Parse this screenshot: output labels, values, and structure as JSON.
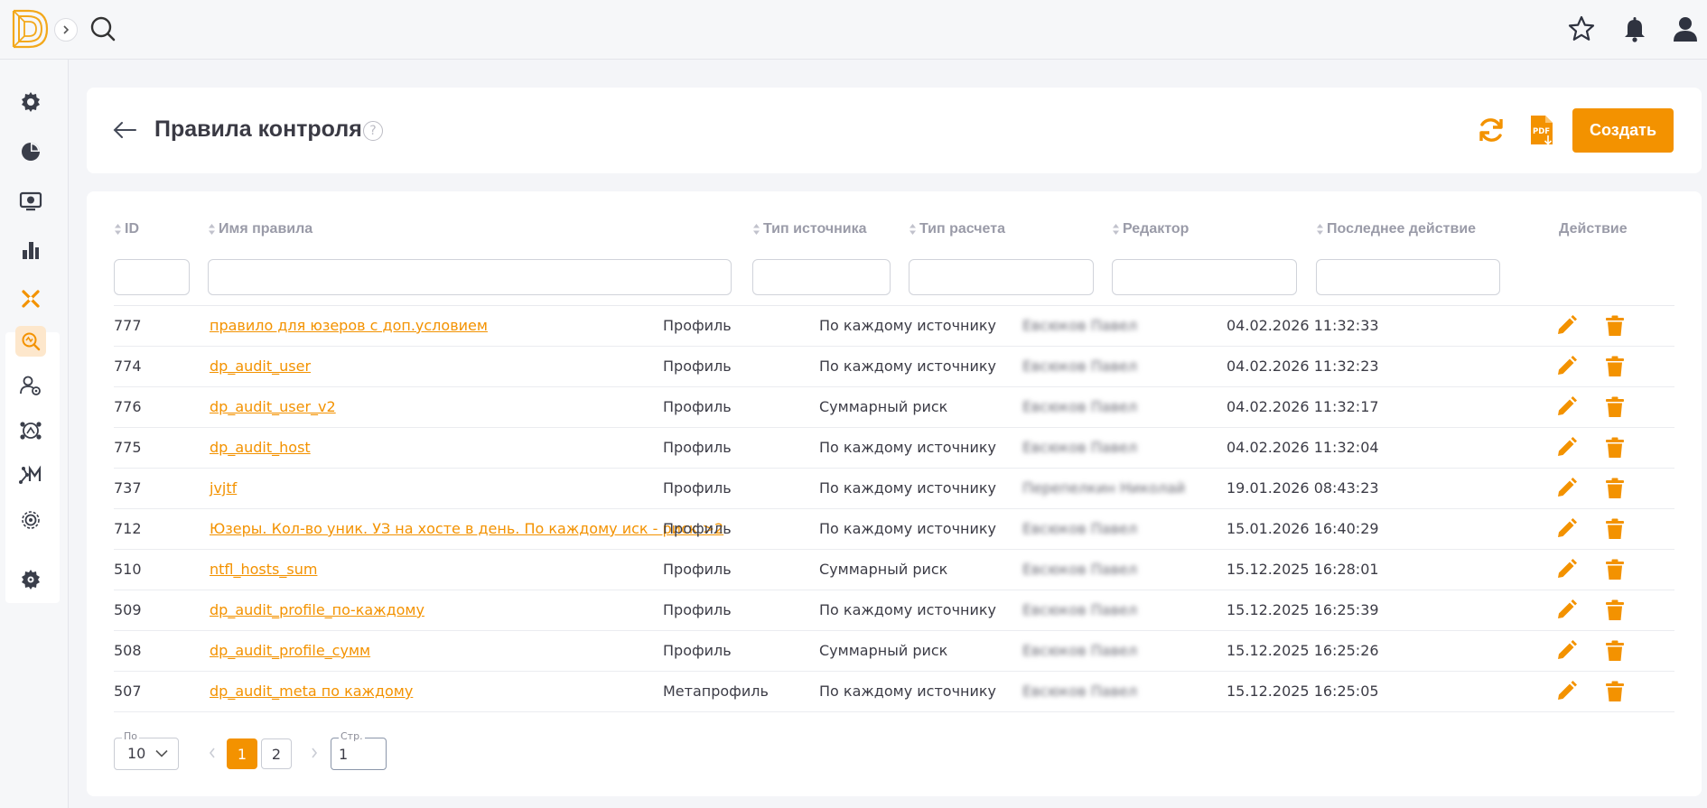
{
  "header": {
    "title": "Правила контроля",
    "help": "?",
    "create_label": "Создать"
  },
  "colors": {
    "accent": "#f39200",
    "muted": "#9a9ba8"
  },
  "columns": {
    "id": "ID",
    "name": "Имя правила",
    "source_type": "Тип источника",
    "calc_type": "Тип расчета",
    "editor": "Редактор",
    "last_action": "Последнее действие",
    "action": "Действие"
  },
  "rows": [
    {
      "id": "777",
      "name": "правило для юзеров с доп.условием",
      "source_type": "Профиль",
      "calc_type": "По каждому источнику",
      "editor": "Евсюков Павел",
      "last_action": "04.02.2026 11:32:33"
    },
    {
      "id": "774",
      "name": "dp_audit_user",
      "source_type": "Профиль",
      "calc_type": "По каждому источнику",
      "editor": "Евсюков Павел",
      "last_action": "04.02.2026 11:32:23"
    },
    {
      "id": "776",
      "name": "dp_audit_user_v2",
      "source_type": "Профиль",
      "calc_type": "Суммарный риск",
      "editor": "Евсюков Павел",
      "last_action": "04.02.2026 11:32:17"
    },
    {
      "id": "775",
      "name": "dp_audit_host",
      "source_type": "Профиль",
      "calc_type": "По каждому источнику",
      "editor": "Евсюков Павел",
      "last_action": "04.02.2026 11:32:04"
    },
    {
      "id": "737",
      "name": "jvjtf",
      "source_type": "Профиль",
      "calc_type": "По каждому источнику",
      "editor": "Перепелкин Николай",
      "last_action": "19.01.2026 08:43:23"
    },
    {
      "id": "712",
      "name": "Юзеры. Кол-во уник. УЗ на хосте в день. По каждому иск - риск >2",
      "source_type": "Профиль",
      "calc_type": "По каждому источнику",
      "editor": "Евсюков Павел",
      "last_action": "15.01.2026 16:40:29"
    },
    {
      "id": "510",
      "name": "ntfl_hosts_sum",
      "source_type": "Профиль",
      "calc_type": "Суммарный риск",
      "editor": "Евсюков Павел",
      "last_action": "15.12.2025 16:28:01"
    },
    {
      "id": "509",
      "name": "dp_audit_profile_по-каждому",
      "source_type": "Профиль",
      "calc_type": "По каждому источнику",
      "editor": "Евсюков Павел",
      "last_action": "15.12.2025 16:25:39"
    },
    {
      "id": "508",
      "name": "dp_audit_profile_сумм",
      "source_type": "Профиль",
      "calc_type": "Суммарный риск",
      "editor": "Евсюков Павел",
      "last_action": "15.12.2025 16:25:26"
    },
    {
      "id": "507",
      "name": "dp_audit_meta по каждому",
      "source_type": "Метапрофиль",
      "calc_type": "По каждому источнику",
      "editor": "Евсюков Павел",
      "last_action": "15.12.2025 16:25:05"
    }
  ],
  "pagination": {
    "per_page_label": "По",
    "per_page_value": "10",
    "pages": [
      "1",
      "2"
    ],
    "current_page": "1",
    "goto_label": "Стр.",
    "goto_value": "1"
  },
  "icons": {
    "sidebar": [
      "gear-icon",
      "pie-chart-icon",
      "monitor-icon",
      "bar-chart-icon",
      "cross-icon",
      "search-zoom-icon",
      "user-settings-icon",
      "network-icon",
      "model-icon",
      "settings-cog-icon",
      "cog-bottom-icon"
    ],
    "top": [
      "search-icon",
      "star-icon",
      "bell-icon",
      "user-icon"
    ]
  }
}
